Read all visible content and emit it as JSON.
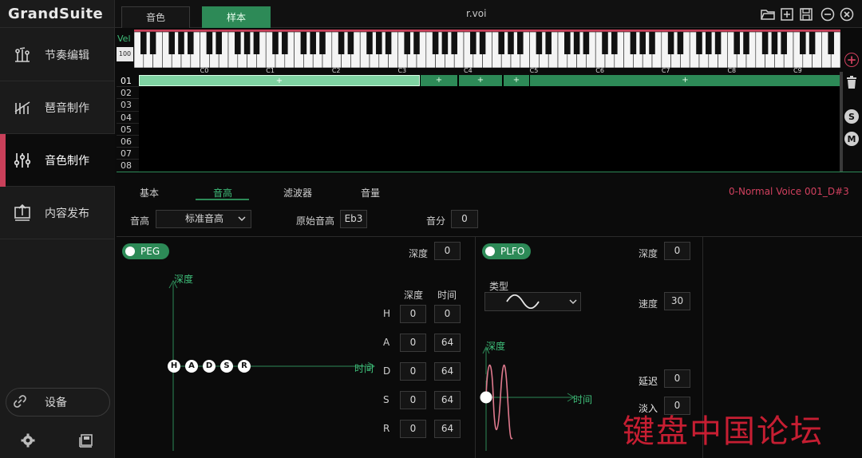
{
  "app": {
    "logo": "GrandSuite"
  },
  "sidebar": {
    "items": [
      {
        "label": "节奏编辑",
        "icon": "rhythm-icon"
      },
      {
        "label": "琶音制作",
        "icon": "arpeggio-icon"
      },
      {
        "label": "音色制作",
        "icon": "sliders-icon",
        "active": true
      },
      {
        "label": "内容发布",
        "icon": "upload-icon"
      }
    ],
    "device_label": "设备",
    "device_icon": "link-icon",
    "settings_icon": "gear-icon",
    "library_icon": "library-icon"
  },
  "topbar": {
    "tabs": [
      {
        "label": "音色"
      },
      {
        "label": "样本",
        "active": true
      }
    ],
    "file_title": "r.voi",
    "buttons": [
      "open-folder-icon",
      "new-file-icon",
      "save-icon",
      "minimize-icon",
      "close-icon"
    ]
  },
  "keyboard": {
    "vel_label": "Vel",
    "vel_value": "100",
    "octave_labels": [
      "C0",
      "C1",
      "C2",
      "C3",
      "C4",
      "C5",
      "C6",
      "C7",
      "C8",
      "C9"
    ]
  },
  "zones": {
    "rows": [
      "01",
      "02",
      "03",
      "04",
      "05",
      "06",
      "07",
      "08"
    ],
    "blocks": [
      {
        "label": "+",
        "selected": true
      },
      {
        "label": "+"
      },
      {
        "label": "+"
      },
      {
        "label": "+"
      },
      {
        "label": "+"
      }
    ]
  },
  "side_buttons": {
    "add": "+",
    "solo": "S",
    "mute": "M"
  },
  "edit_tabs": {
    "tabs": [
      "基本",
      "音高",
      "滤波器",
      "音量"
    ],
    "active": "音高",
    "voice_name": "0-Normal Voice 001_D#3"
  },
  "pitch_params": {
    "pitch_label": "音高",
    "pitch_value": "标准音高",
    "original_pitch_label": "原始音高",
    "original_pitch_value": "Eb3",
    "cent_label": "音分",
    "cent_value": "0"
  },
  "peg": {
    "toggle_label": "PEG",
    "depth_label": "深度",
    "depth_value": "0",
    "axis_y": "深度",
    "axis_x": "时间",
    "col_depth": "深度",
    "col_time": "时间",
    "points": [
      "H",
      "A",
      "D",
      "S",
      "R"
    ],
    "rows": [
      {
        "letter": "H",
        "depth": "0",
        "time": "0"
      },
      {
        "letter": "A",
        "depth": "0",
        "time": "64"
      },
      {
        "letter": "D",
        "depth": "0",
        "time": "64"
      },
      {
        "letter": "S",
        "depth": "0",
        "time": "64"
      },
      {
        "letter": "R",
        "depth": "0",
        "time": "64"
      }
    ]
  },
  "plfo": {
    "toggle_label": "PLFO",
    "type_label": "类型",
    "wave_icon": "sine-wave-icon",
    "depth_label": "深度",
    "depth_value": "0",
    "speed_label": "速度",
    "speed_value": "30",
    "delay_label": "延迟",
    "delay_value": "0",
    "fade_label": "淡入",
    "fade_value": "0",
    "axis_y": "深度",
    "axis_x": "时间",
    "marker": "I"
  },
  "watermark": "键盘中国论坛",
  "colors": {
    "accent_green": "#2d8a57",
    "accent_red": "#c9405a",
    "wave_pink": "#e07a8e"
  }
}
